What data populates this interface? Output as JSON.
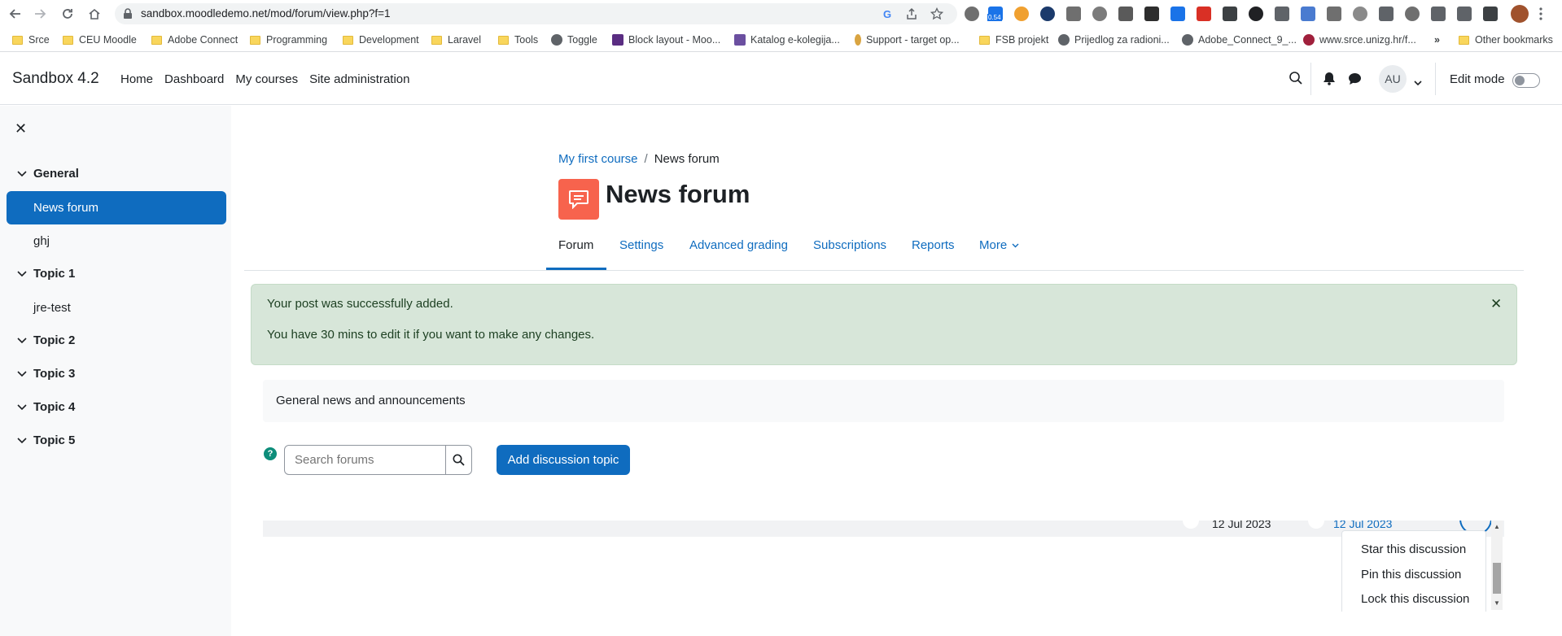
{
  "browser": {
    "url": "sandbox.moodledemo.net/mod/forum/view.php?f=1",
    "extension_badge": "0.54",
    "bookmarks": [
      {
        "label": "Srce",
        "type": "folder"
      },
      {
        "label": "CEU Moodle",
        "type": "folder"
      },
      {
        "label": "Adobe Connect",
        "type": "folder"
      },
      {
        "label": "Programming",
        "type": "folder"
      },
      {
        "label": "Development",
        "type": "folder"
      },
      {
        "label": "Laravel",
        "type": "folder"
      },
      {
        "label": "Tools",
        "type": "folder"
      },
      {
        "label": "Toggle",
        "type": "site"
      },
      {
        "label": "Block layout - Moo...",
        "type": "site"
      },
      {
        "label": "Katalog e-kolegija...",
        "type": "site"
      },
      {
        "label": "Support - target op...",
        "type": "site"
      },
      {
        "label": "FSB projekt",
        "type": "folder"
      },
      {
        "label": "Prijedlog za radioni...",
        "type": "site"
      },
      {
        "label": "Adobe_Connect_9_...",
        "type": "site"
      },
      {
        "label": "www.srce.unizg.hr/f...",
        "type": "site"
      }
    ],
    "more_bookmarks": "»",
    "other_bookmarks": "Other bookmarks"
  },
  "navbar": {
    "brand": "Sandbox 4.2",
    "links": [
      "Home",
      "Dashboard",
      "My courses",
      "Site administration"
    ],
    "avatar_initials": "AU",
    "edit_mode_label": "Edit mode"
  },
  "course_index": {
    "close_symbol": "✕",
    "sections": [
      {
        "title": "General",
        "items": [
          "News forum",
          "ghj"
        ]
      },
      {
        "title": "Topic 1",
        "items": [
          "jre-test"
        ]
      },
      {
        "title": "Topic 2",
        "items": []
      },
      {
        "title": "Topic 3",
        "items": []
      },
      {
        "title": "Topic 4",
        "items": []
      },
      {
        "title": "Topic 5",
        "items": []
      }
    ],
    "active_item": "News forum"
  },
  "page": {
    "breadcrumb": [
      "My first course",
      "News forum"
    ],
    "breadcrumb_sep": "/",
    "title": "News forum",
    "tabs": [
      "Forum",
      "Settings",
      "Advanced grading",
      "Subscriptions",
      "Reports",
      "More"
    ],
    "active_tab": "Forum",
    "alert": {
      "line1": "Your post was successfully added.",
      "line2": "You have 30 mins to edit it if you want to make any changes.",
      "close_symbol": "✕"
    },
    "intro": "General news and announcements",
    "help_symbol": "?",
    "search_placeholder": "Search forums",
    "add_button": "Add discussion topic",
    "discussion_row": {
      "date_started": "12 Jul 2023",
      "last_post": "12 Jul 2023"
    },
    "row_menu": [
      "Star this discussion",
      "Pin this discussion",
      "Lock this discussion"
    ]
  },
  "colors": {
    "moodle_blue": "#0f6cbf",
    "forum_icon": "#f7634d",
    "alert_bg": "#d7e6d9"
  }
}
